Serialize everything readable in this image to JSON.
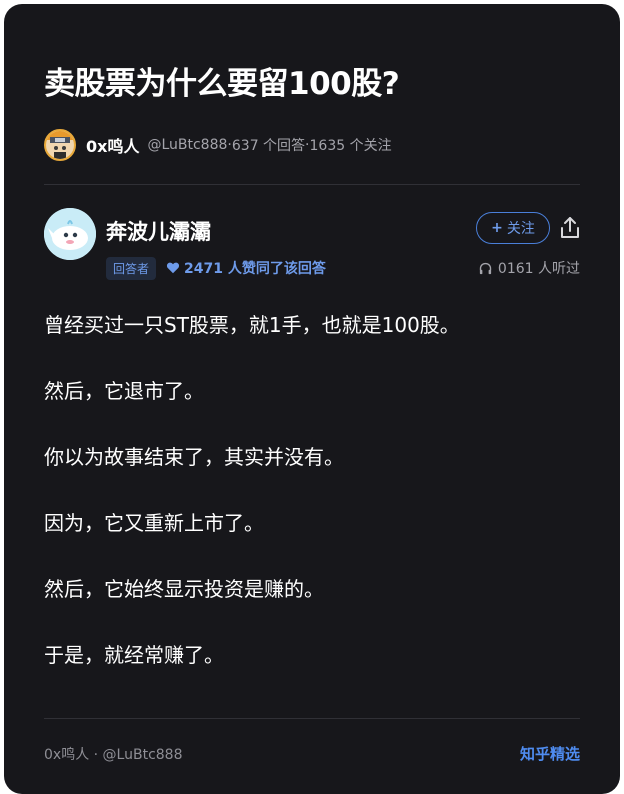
{
  "question": {
    "title": "卖股票为什么要留100股?",
    "asker_name": "0x鸣人",
    "asker_handle": "@LuBtc888",
    "answer_count": "637 个回答",
    "follower_count": "1635 个关注"
  },
  "answer": {
    "author_name": "奔波儿灞灞",
    "role_badge": "回答者",
    "agree_text": "2471 人赞同了该回答",
    "follow_label": "关注",
    "listen_text": "0161 人听过",
    "paragraphs": [
      "曾经买过一只ST股票，就1手，也就是100股。",
      "然后，它退市了。",
      "你以为故事结束了，其实并没有。",
      "因为，它又重新上市了。",
      "然后，它始终显示投资是赚的。",
      "于是，就经常赚了。"
    ]
  },
  "footer": {
    "credit": "0x鸣人 · @LuBtc888",
    "brand": "知乎精选"
  },
  "icons": {
    "asker_avatar": "ninja-avatar",
    "answer_avatar": "whale-avatar",
    "heart": "heart-icon",
    "share": "share-icon",
    "headphone": "headphone-icon"
  },
  "colors": {
    "background": "#17171b",
    "accent": "#4f8cf0",
    "muted": "#a4a4ab"
  }
}
